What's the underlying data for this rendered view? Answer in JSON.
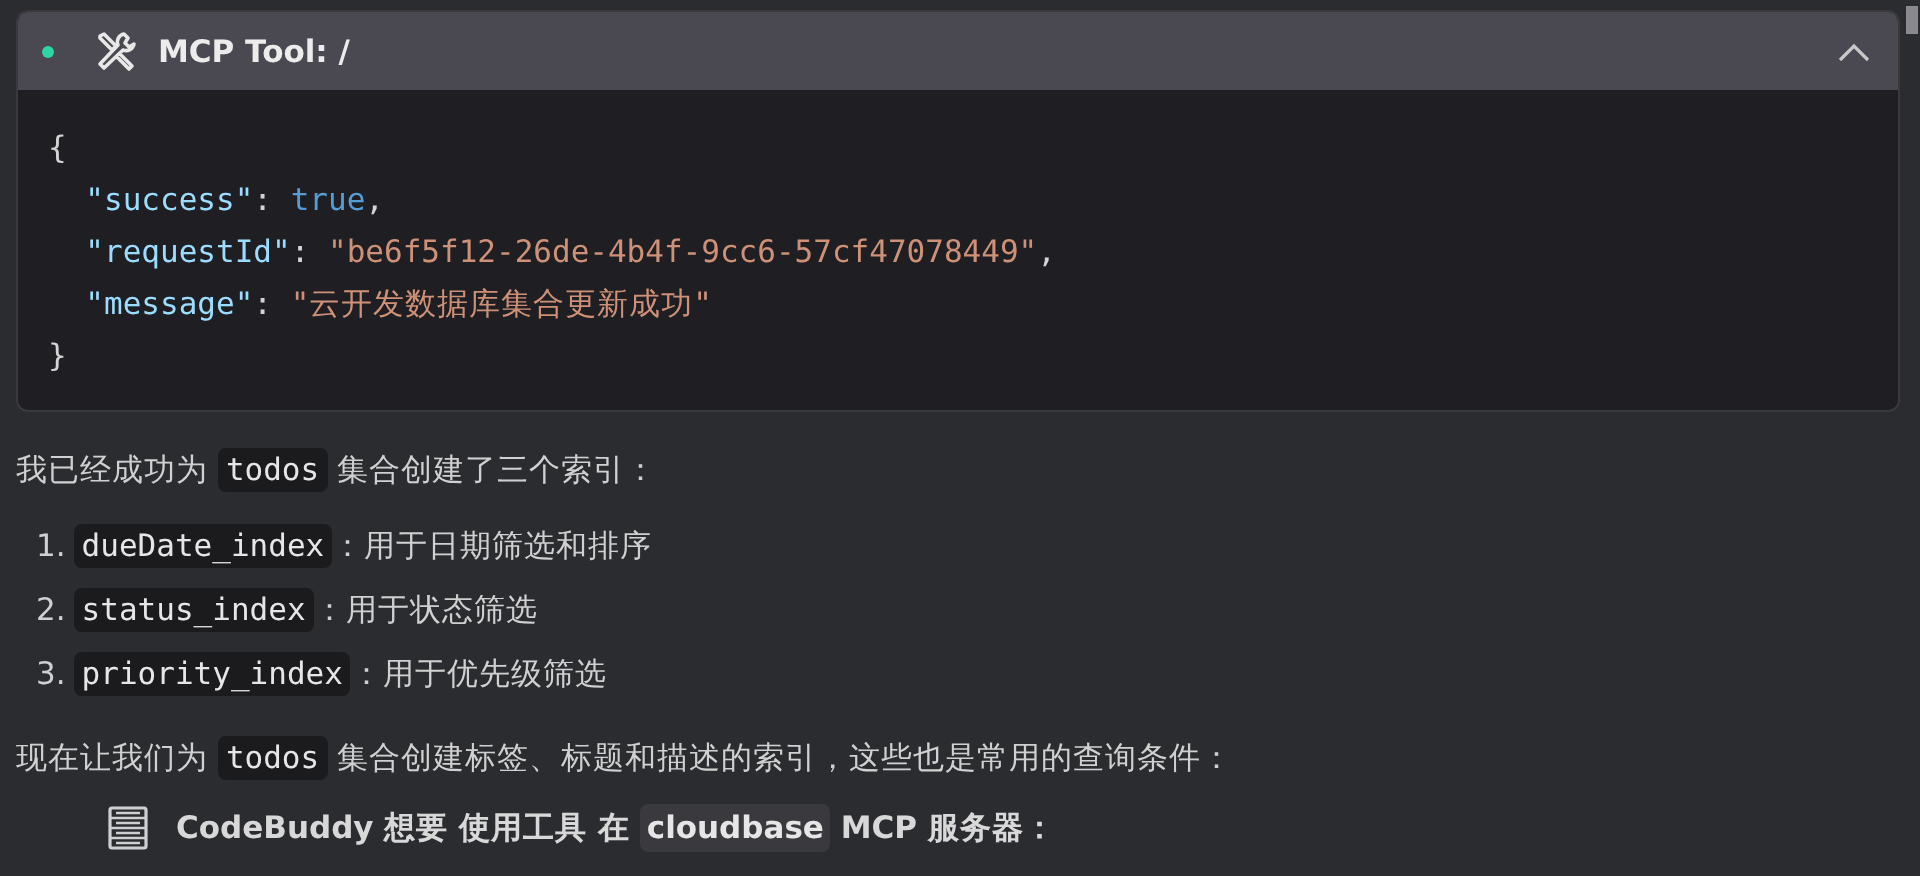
{
  "tool_card": {
    "title": "MCP Tool: /",
    "expanded": true,
    "code_lines": [
      [
        {
          "kind": "punct",
          "text": "{"
        }
      ],
      [
        {
          "kind": "key",
          "text": "  \"success\""
        },
        {
          "kind": "punct",
          "text": ": "
        },
        {
          "kind": "bool",
          "text": "true"
        },
        {
          "kind": "punct",
          "text": ","
        }
      ],
      [
        {
          "kind": "key",
          "text": "  \"requestId\""
        },
        {
          "kind": "punct",
          "text": ": "
        },
        {
          "kind": "string",
          "text": "\"be6f5f12-26de-4b4f-9cc6-57cf47078449\""
        },
        {
          "kind": "punct",
          "text": ","
        }
      ],
      [
        {
          "kind": "key",
          "text": "  \"message\""
        },
        {
          "kind": "punct",
          "text": ": "
        },
        {
          "kind": "string",
          "text": "\"云开发数据库集合更新成功\""
        }
      ],
      [
        {
          "kind": "punct",
          "text": "}"
        }
      ]
    ]
  },
  "intro": [
    {
      "kind": "text",
      "text": "我已经成功为 "
    },
    {
      "kind": "code",
      "text": "todos"
    },
    {
      "kind": "text",
      "text": " 集合创建了三个索引："
    }
  ],
  "indexes": [
    {
      "number": "1.",
      "segments": [
        {
          "kind": "code",
          "text": "dueDate_index"
        },
        {
          "kind": "text",
          "text": "：用于日期筛选和排序"
        }
      ]
    },
    {
      "number": "2.",
      "segments": [
        {
          "kind": "code",
          "text": "status_index"
        },
        {
          "kind": "text",
          "text": "：用于状态筛选"
        }
      ]
    },
    {
      "number": "3.",
      "segments": [
        {
          "kind": "code",
          "text": "priority_index"
        },
        {
          "kind": "text",
          "text": "：用于优先级筛选"
        }
      ]
    }
  ],
  "next": [
    {
      "kind": "text",
      "text": "现在让我们为 "
    },
    {
      "kind": "code",
      "text": "todos"
    },
    {
      "kind": "text",
      "text": " 集合创建标签、标题和描述的索引，这些也是常用的查询条件："
    }
  ],
  "permission": [
    {
      "kind": "text",
      "text": "CodeBuddy 想要 使用工具 在 "
    },
    {
      "kind": "code",
      "text": "cloudbase"
    },
    {
      "kind": "text",
      "text": " MCP 服务器："
    }
  ]
}
